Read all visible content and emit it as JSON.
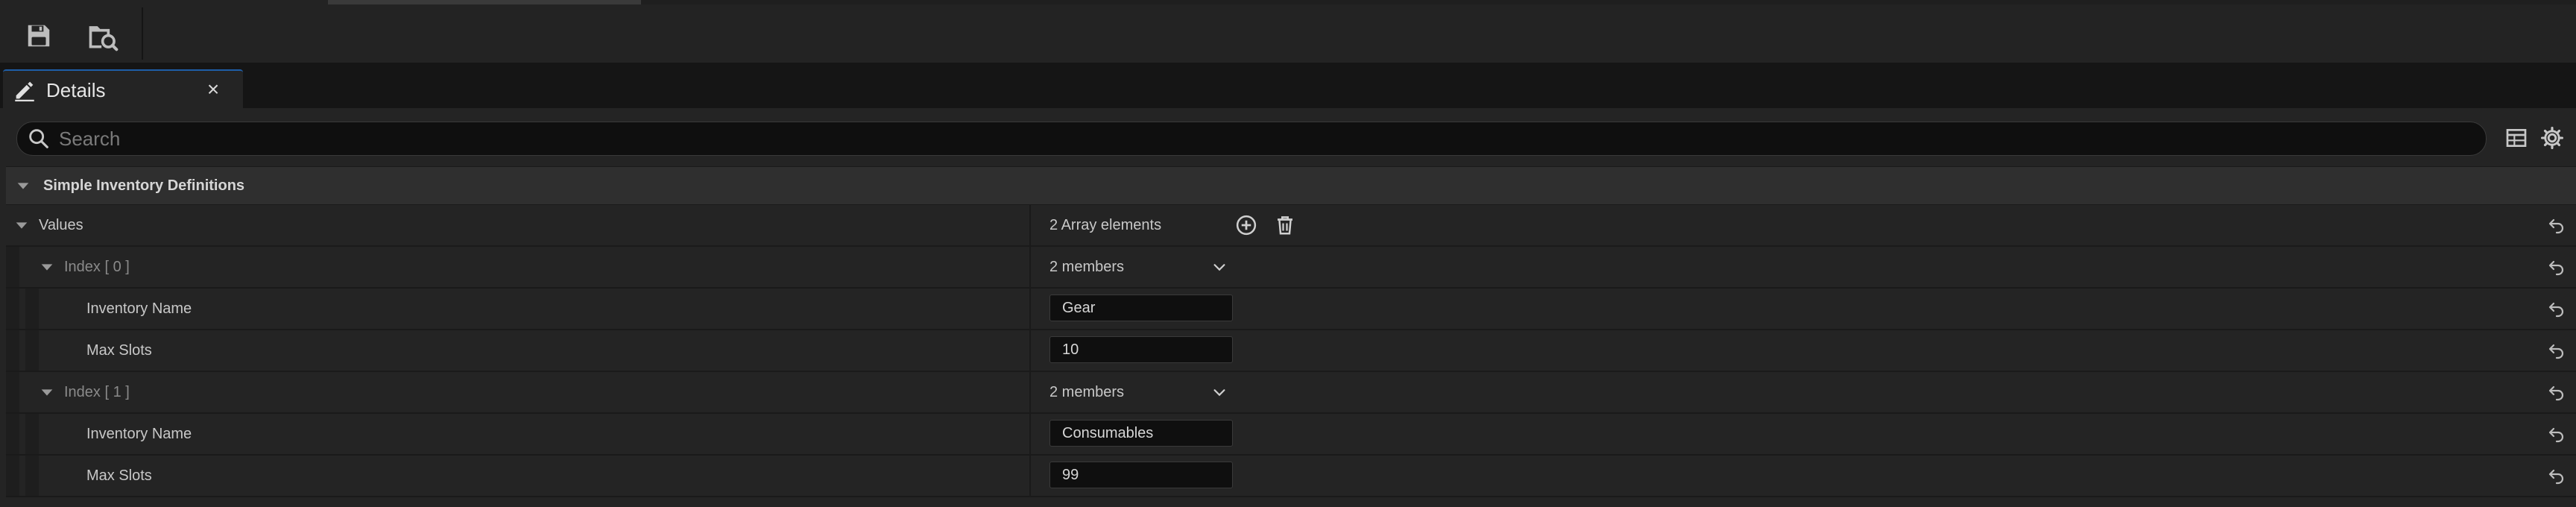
{
  "toolbar": {
    "icons": [
      "save-icon",
      "browse-asset-icon"
    ]
  },
  "tab": {
    "label": "Details",
    "close_glyph": "×"
  },
  "search": {
    "placeholder": "Search"
  },
  "category": {
    "label": "Simple Inventory Definitions"
  },
  "rows": {
    "values": {
      "label": "Values",
      "value": "2 Array elements"
    },
    "index0": {
      "label": "Index [ 0 ]",
      "value": "2 members"
    },
    "index0_name": {
      "label": "Inventory Name",
      "value": "Gear"
    },
    "index0_slots": {
      "label": "Max Slots",
      "value": "10"
    },
    "index1": {
      "label": "Index [ 1 ]",
      "value": "2 members"
    },
    "index1_name": {
      "label": "Inventory Name",
      "value": "Consumables"
    },
    "index1_slots": {
      "label": "Max Slots",
      "value": "99"
    }
  },
  "colors": {
    "accent": "#1e5ea8",
    "panel_bg": "#242424",
    "category_bg": "#2f2f2f",
    "field_bg": "#0f0f0f"
  }
}
